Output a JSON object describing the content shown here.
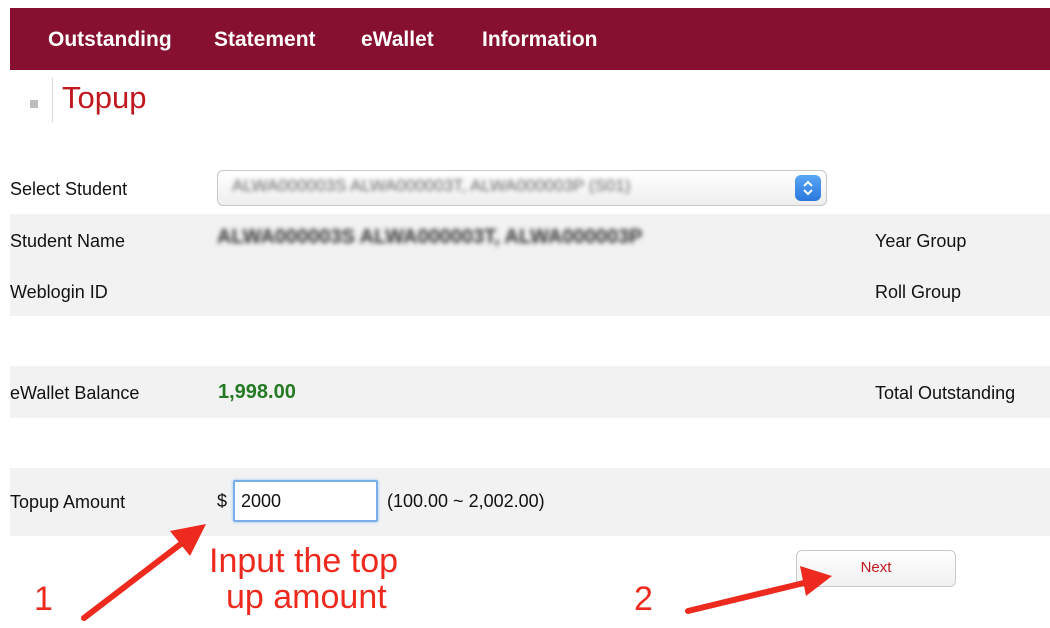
{
  "nav": {
    "items": [
      "Outstanding",
      "Statement",
      "eWallet",
      "Information"
    ]
  },
  "page": {
    "title": "Topup"
  },
  "student_select": {
    "label": "Select Student",
    "selected_value": "ALWA000003S ALWA000003T, ALWA000003P (S01)"
  },
  "student_info": {
    "name_label": "Student Name",
    "name_value": "ALWA000003S ALWA000003T, ALWA000003P",
    "year_group_label": "Year Group",
    "weblogin_label": "Weblogin ID",
    "roll_group_label": "Roll Group"
  },
  "balance": {
    "label": "eWallet Balance",
    "value": "1,998.00",
    "total_outstanding_label": "Total Outstanding"
  },
  "topup": {
    "label": "Topup Amount",
    "currency": "$",
    "amount_value": "2000",
    "range_text": "(100.00 ~ 2,002.00)"
  },
  "actions": {
    "next_label": "Next"
  },
  "annotations": {
    "step1": "1",
    "instruction_line1": "Input the top",
    "instruction_line2": "up amount",
    "step2": "2"
  },
  "colors": {
    "nav_bg": "#870f2f",
    "title": "#c0181f",
    "balance": "#237a23",
    "annotation": "#ee2a1f"
  }
}
